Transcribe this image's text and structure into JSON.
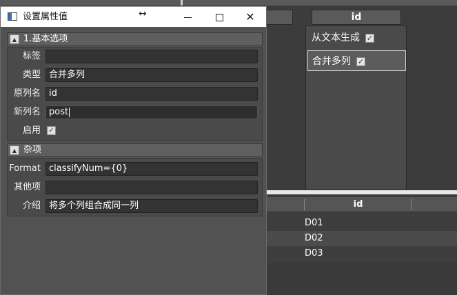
{
  "background": {
    "header_left_label": "",
    "header_id_label": "id",
    "panel_items": [
      {
        "label": "从文本生成",
        "checked": true
      },
      {
        "label": "合并多列",
        "checked": true
      }
    ],
    "grid": {
      "column_header": "id",
      "rows": [
        "D01",
        "D02",
        "D03"
      ]
    }
  },
  "dialog": {
    "title": "设置属性值",
    "resize_glyph": "↔",
    "close_glyph": "✕",
    "sections": [
      {
        "title": "1.基本选项",
        "toggle": "▲",
        "rows": [
          {
            "label": "标签",
            "value": ""
          },
          {
            "label": "类型",
            "value": "合并多列"
          },
          {
            "label": "原列名",
            "value": "id"
          },
          {
            "label": "新列名",
            "value": "post"
          },
          {
            "label": "启用",
            "checked": true
          }
        ]
      },
      {
        "title": "杂项",
        "toggle": "▲",
        "rows": [
          {
            "label": "Format",
            "value": "classifyNum={0}"
          },
          {
            "label": "其他项",
            "value": ""
          },
          {
            "label": "介绍",
            "value": "将多个列组合成同一列"
          }
        ]
      }
    ]
  },
  "icons": {
    "checkmark": "✓"
  },
  "colors": {
    "background": "#3c3c3c",
    "dialog_bg": "#525252",
    "field_bg": "#333333",
    "titlebar_bg": "#ffffff"
  }
}
